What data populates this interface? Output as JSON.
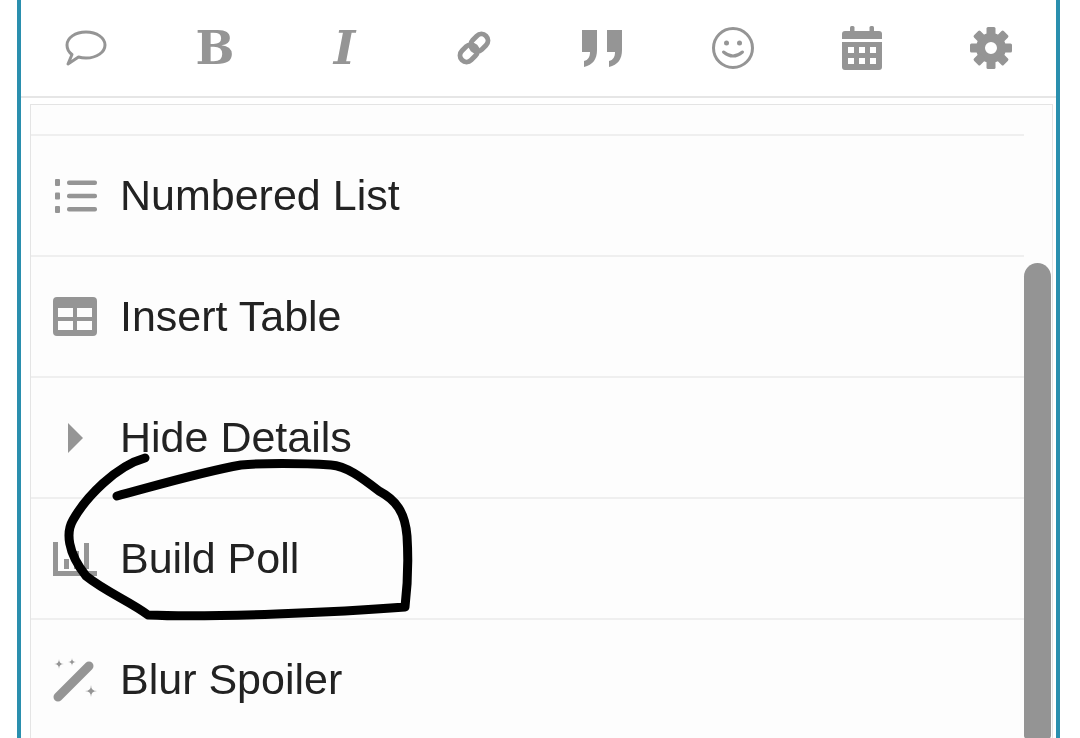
{
  "toolbar": [
    {
      "kind": "chat"
    },
    {
      "kind": "bold",
      "glyph": "B"
    },
    {
      "kind": "italic",
      "glyph": "I"
    },
    {
      "kind": "link"
    },
    {
      "kind": "quote"
    },
    {
      "kind": "emoji"
    },
    {
      "kind": "calendar"
    },
    {
      "kind": "settings"
    }
  ],
  "menu": {
    "items": [
      {
        "kind": "numbered-list",
        "label": "Numbered List",
        "circled": false
      },
      {
        "kind": "table",
        "label": "Insert Table",
        "circled": false
      },
      {
        "kind": "details",
        "label": "Hide Details",
        "circled": false
      },
      {
        "kind": "poll",
        "label": "Build Poll",
        "circled": true
      },
      {
        "kind": "spoiler",
        "label": "Blur Spoiler",
        "circled": false
      }
    ]
  }
}
